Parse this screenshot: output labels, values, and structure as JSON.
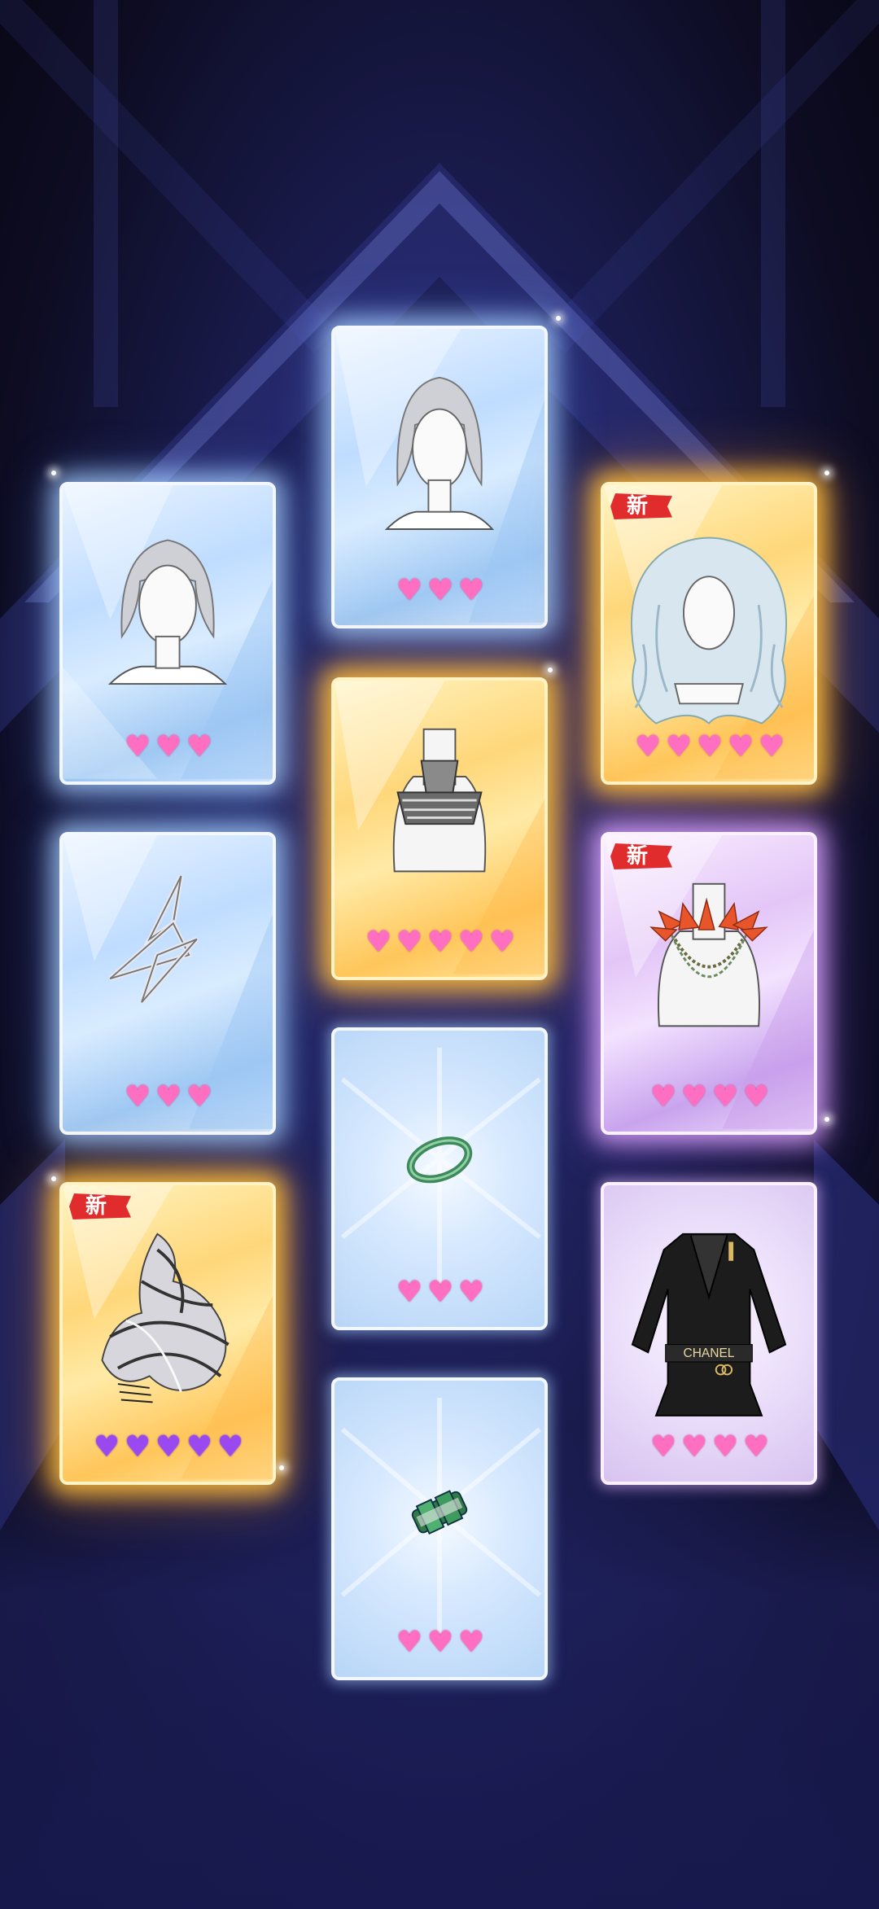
{
  "screen": {
    "background": "#1b1d52"
  },
  "cards": [
    {
      "id": "card-1",
      "item": "silver-bob-hair",
      "rarity": "blue",
      "hearts": 3,
      "heart_color": "pink",
      "is_new": false
    },
    {
      "id": "card-2",
      "item": "silver-bob-hair",
      "rarity": "blue",
      "hearts": 3,
      "heart_color": "pink",
      "is_new": false
    },
    {
      "id": "card-3",
      "item": "silver-long-wavy-hair",
      "rarity": "gold",
      "hearts": 5,
      "heart_color": "pink",
      "is_new": true,
      "badge": "新"
    },
    {
      "id": "card-4",
      "item": "layered-collar-necklace",
      "rarity": "gold",
      "hearts": 5,
      "heart_color": "pink",
      "is_new": false
    },
    {
      "id": "card-5",
      "item": "geometric-triangle-earring",
      "rarity": "blue",
      "hearts": 3,
      "heart_color": "pink",
      "is_new": false
    },
    {
      "id": "card-6",
      "item": "red-lily-chain-necklace",
      "rarity": "purple",
      "hearts": 4,
      "heart_color": "pink",
      "is_new": true,
      "badge": "新"
    },
    {
      "id": "card-7",
      "item": "jade-bangle",
      "rarity": "blue-plain",
      "hearts": 3,
      "heart_color": "pink",
      "is_new": false
    },
    {
      "id": "card-8",
      "item": "black-chanel-belted-jacket",
      "rarity": "purple-plain",
      "hearts": 4,
      "heart_color": "pink",
      "is_new": false,
      "label_text": "CHANEL"
    },
    {
      "id": "card-9",
      "item": "silver-ribbon-sculpture-outfit",
      "rarity": "gold",
      "hearts": 5,
      "heart_color": "violet",
      "is_new": true,
      "badge": "新"
    },
    {
      "id": "card-10",
      "item": "emerald-ring",
      "rarity": "blue-plain",
      "hearts": 3,
      "heart_color": "pink",
      "is_new": false
    }
  ],
  "heart_glyph": "♥",
  "colors": {
    "pink_heart": "#ff6fc1",
    "violet_heart": "#9a48f0",
    "new_badge": "#e02c2c"
  }
}
